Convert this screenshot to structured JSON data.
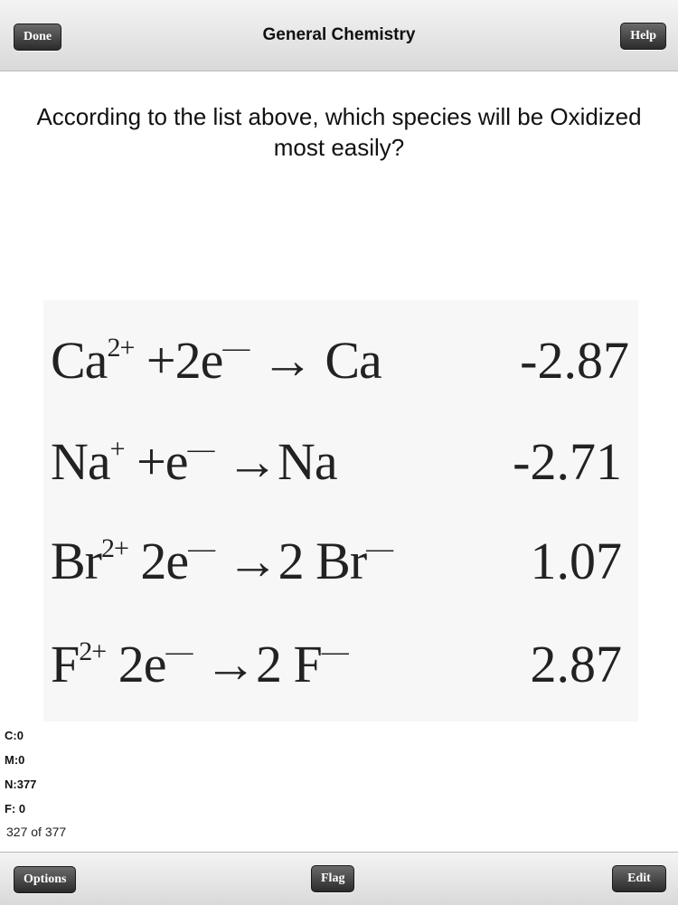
{
  "nav": {
    "title": "General Chemistry",
    "done_label": "Done",
    "help_label": "Help"
  },
  "question": "According to the list above, which species will be Oxidized most easily?",
  "reactions": [
    {
      "left": "Ca",
      "left_sup": "2+",
      "mid": " +2e",
      "mid_sup": "—",
      "arrow": " → ",
      "product": "Ca",
      "product_sup": "",
      "value": "-2.87"
    },
    {
      "left": "Na",
      "left_sup": "+",
      "mid": " +e",
      "mid_sup": "—",
      "arrow": " →",
      "product": "Na",
      "product_sup": "",
      "value": "-2.71"
    },
    {
      "left": "Br",
      "left_sup": "2+",
      "mid": " 2e",
      "mid_sup": "—",
      "arrow": " →",
      "product": "2 Br",
      "product_sup": "—",
      "value": "1.07"
    },
    {
      "left": "F",
      "left_sup": "2+",
      "mid": " 2e",
      "mid_sup": "—",
      "arrow": " →",
      "product": "2 F",
      "product_sup": "—",
      "value": "2.87"
    }
  ],
  "stats": {
    "c": "C:0",
    "m": "M:0",
    "n": "N:377",
    "f": "F: 0"
  },
  "counter": "327 of 377",
  "toolbar": {
    "options_label": "Options",
    "flag_label": "Flag",
    "edit_label": "Edit"
  }
}
